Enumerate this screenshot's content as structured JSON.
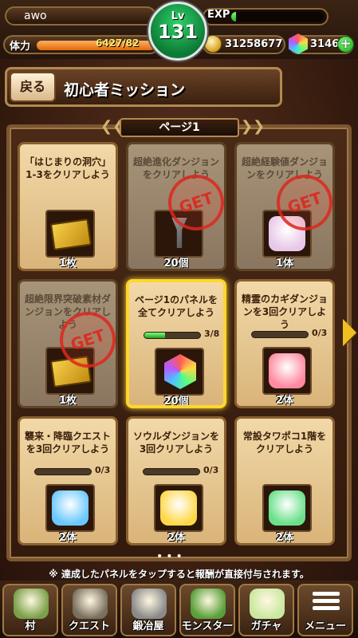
{
  "player": {
    "name": "awo",
    "level_label": "Lv",
    "level": "131",
    "exp_label": "EXP",
    "exp_fraction": 0.05,
    "stamina_label": "体力",
    "stamina_text": "6427/82",
    "stamina_fraction": 1.0,
    "coins": "31258677",
    "gems": "3146",
    "plus_symbol": "+"
  },
  "header": {
    "back_label": "戻る",
    "title": "初心者ミッション"
  },
  "page": {
    "label": "ページ1",
    "left_chevron": "❮❮",
    "right_chevron": "❯❯"
  },
  "panels": [
    {
      "text": "「はじまりの洞穴」1-3をクリアしよう",
      "reward": "1枚",
      "stamp": "",
      "progress_text": ""
    },
    {
      "text": "超絶進化ダンジョンをクリアしよう",
      "reward": "20個",
      "stamp": "GET",
      "progress_text": ""
    },
    {
      "text": "超絶経験値ダンジョンをクリアしよう",
      "reward": "1体",
      "stamp": "GET",
      "progress_text": ""
    },
    {
      "text": "超絶限界突破素材ダンジョンをクリアしよう",
      "reward": "1枚",
      "stamp": "GET",
      "progress_text": ""
    },
    {
      "text": "ページ1のパネルを全てクリアしよう",
      "reward": "20個",
      "stamp": "",
      "progress_text": "3/8",
      "progress_fraction": 0.375
    },
    {
      "text": "精霊のカギダンジョンを3回クリアしよう",
      "reward": "2体",
      "stamp": "",
      "progress_text": "0/3",
      "progress_fraction": 0
    },
    {
      "text": "襲来・降臨クエストを3回クリアしよう",
      "reward": "2体",
      "stamp": "",
      "progress_text": "0/3",
      "progress_fraction": 0
    },
    {
      "text": "ソウルダンジョンを3回クリアしよう",
      "reward": "2体",
      "stamp": "",
      "progress_text": "0/3",
      "progress_fraction": 0
    },
    {
      "text": "常設タワポコ1階をクリアしよう",
      "reward": "2体",
      "stamp": "",
      "progress_text": "",
      "progress_fraction": 0
    }
  ],
  "pager_dots": "•••",
  "notice": "※ 達成したパネルをタップすると報酬が直接付与されます。",
  "nav": [
    {
      "label": "村",
      "icon": "village-icon",
      "color": "#7aa04a"
    },
    {
      "label": "クエスト",
      "icon": "cave-icon",
      "color": "#7a7060"
    },
    {
      "label": "鍛冶屋",
      "icon": "hammer-icon",
      "color": "#8a8a8a"
    },
    {
      "label": "モンスター",
      "icon": "monster-icon",
      "color": "#5aa03a"
    },
    {
      "label": "ガチャ",
      "icon": "egg-icon",
      "color": "#c8e8a0"
    },
    {
      "label": "メニュー",
      "icon": "menu-icon",
      "color": "#6b4a2c"
    }
  ],
  "colors": {
    "accent_gold": "#ffd630",
    "stamp_red": "#dc281e",
    "progress_green": "#22a022"
  }
}
